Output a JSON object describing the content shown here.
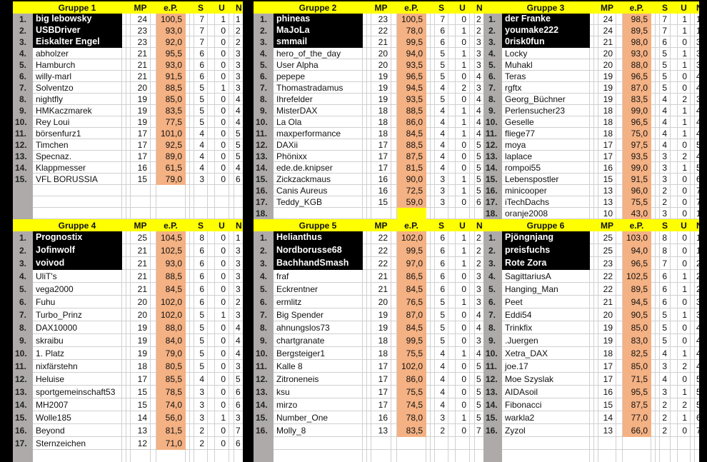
{
  "colors": {
    "header": "#ffff00",
    "ep_column": "#f4b183",
    "rank_column": "#aeaaaa",
    "podium": "#000000"
  },
  "columns": {
    "mp": "MP",
    "ep": "e.P.",
    "s": "S",
    "u": "U",
    "n": "N"
  },
  "groups": [
    {
      "title": "Gruppe 1",
      "rows": [
        [
          "1.",
          "big lebowsky",
          "24",
          "100,5",
          "7",
          "1",
          "1"
        ],
        [
          "2.",
          "USBDriver",
          "23",
          "93,0",
          "7",
          "0",
          "2"
        ],
        [
          "3.",
          "Eiskalter Engel",
          "23",
          "92,0",
          "7",
          "0",
          "2"
        ],
        [
          "4.",
          "abholzer",
          "21",
          "95,5",
          "6",
          "0",
          "3"
        ],
        [
          "5.",
          "Hamburch",
          "21",
          "93,0",
          "6",
          "0",
          "3"
        ],
        [
          "6.",
          "willy-marl",
          "21",
          "91,5",
          "6",
          "0",
          "3"
        ],
        [
          "7.",
          "Solventzo",
          "20",
          "88,5",
          "5",
          "1",
          "3"
        ],
        [
          "8.",
          "nightfly",
          "19",
          "85,0",
          "5",
          "0",
          "4"
        ],
        [
          "9.",
          "HMKaczmarek",
          "19",
          "83,5",
          "5",
          "0",
          "4"
        ],
        [
          "10.",
          "Rey Loui",
          "19",
          "77,5",
          "5",
          "0",
          "4"
        ],
        [
          "11.",
          "börsenfurz1",
          "17",
          "101,0",
          "4",
          "0",
          "5"
        ],
        [
          "12.",
          "Timchen",
          "17",
          "92,5",
          "4",
          "0",
          "5"
        ],
        [
          "13.",
          "Specnaz.",
          "17",
          "89,0",
          "4",
          "0",
          "5"
        ],
        [
          "14.",
          "Klappmesser",
          "16",
          "61,5",
          "4",
          "0",
          "4"
        ],
        [
          "15.",
          "VFL BORUSSIA",
          "15",
          "79,0",
          "3",
          "0",
          "6"
        ]
      ]
    },
    {
      "title": "Gruppe 2",
      "empty_ep_color": "#ffff00",
      "rows": [
        [
          "1.",
          "phineas",
          "23",
          "100,5",
          "7",
          "0",
          "2"
        ],
        [
          "2.",
          "MaJoLa",
          "22",
          "78,0",
          "6",
          "1",
          "2"
        ],
        [
          "3.",
          "smmail",
          "21",
          "99,5",
          "6",
          "0",
          "3"
        ],
        [
          "4.",
          "hero_of_the_day",
          "20",
          "94,0",
          "5",
          "1",
          "3"
        ],
        [
          "5.",
          "User Alpha",
          "20",
          "93,5",
          "5",
          "1",
          "3"
        ],
        [
          "6.",
          "pepepe",
          "19",
          "96,5",
          "5",
          "0",
          "4"
        ],
        [
          "7.",
          "Thomastradamus",
          "19",
          "94,5",
          "4",
          "2",
          "3"
        ],
        [
          "8.",
          "Ihrefelder",
          "19",
          "93,5",
          "5",
          "0",
          "4"
        ],
        [
          "9.",
          "MisterDAX",
          "18",
          "88,5",
          "4",
          "1",
          "4"
        ],
        [
          "10.",
          "La Ola",
          "18",
          "86,0",
          "4",
          "1",
          "4"
        ],
        [
          "11.",
          "maxperformance",
          "18",
          "84,5",
          "4",
          "1",
          "4"
        ],
        [
          "12.",
          "DAXii",
          "17",
          "88,5",
          "4",
          "0",
          "5"
        ],
        [
          "13.",
          "Phönixx",
          "17",
          "87,5",
          "4",
          "0",
          "5"
        ],
        [
          "14.",
          "ede.de.knipser",
          "17",
          "81,5",
          "4",
          "0",
          "5"
        ],
        [
          "15.",
          "Zickzackmaus",
          "16",
          "90,0",
          "3",
          "1",
          "5"
        ],
        [
          "16.",
          "Canis Aureus",
          "16",
          "72,5",
          "3",
          "1",
          "5"
        ],
        [
          "17.",
          "Teddy_KGB",
          "15",
          "59,0",
          "3",
          "0",
          "6"
        ],
        [
          "18.",
          "",
          "",
          "",
          "",
          "",
          ""
        ]
      ]
    },
    {
      "title": "Gruppe 3",
      "rows": [
        [
          "1.",
          "der Franke",
          "24",
          "98,5",
          "7",
          "1",
          "1"
        ],
        [
          "2.",
          "youmake222",
          "24",
          "89,5",
          "7",
          "1",
          "1"
        ],
        [
          "3.",
          "0risk0fun",
          "21",
          "98,0",
          "6",
          "0",
          "3"
        ],
        [
          "4.",
          "Locky",
          "20",
          "93,0",
          "5",
          "1",
          "3"
        ],
        [
          "5.",
          "Muhakl",
          "20",
          "88,0",
          "5",
          "1",
          "3"
        ],
        [
          "6.",
          "Teras",
          "19",
          "96,5",
          "5",
          "0",
          "4"
        ],
        [
          "7.",
          "rgftx",
          "19",
          "87,0",
          "5",
          "0",
          "4"
        ],
        [
          "8.",
          "Georg_Büchner",
          "19",
          "83,5",
          "4",
          "2",
          "3"
        ],
        [
          "9.",
          "Perlensucher23",
          "18",
          "99,0",
          "4",
          "1",
          "4"
        ],
        [
          "10.",
          "Geselle",
          "18",
          "96,5",
          "4",
          "1",
          "4"
        ],
        [
          "11.",
          "fliege77",
          "18",
          "75,0",
          "4",
          "1",
          "4"
        ],
        [
          "12.",
          "moya",
          "17",
          "97,5",
          "4",
          "0",
          "5"
        ],
        [
          "13.",
          "laplace",
          "17",
          "93,5",
          "3",
          "2",
          "4"
        ],
        [
          "14.",
          "rompoi55",
          "16",
          "99,0",
          "3",
          "1",
          "5"
        ],
        [
          "15.",
          "Lebenspostler",
          "15",
          "91,5",
          "3",
          "0",
          "6"
        ],
        [
          "16.",
          "minicooper",
          "13",
          "96,0",
          "2",
          "0",
          "7"
        ],
        [
          "17.",
          "iTechDachs",
          "13",
          "75,5",
          "2",
          "0",
          "7"
        ],
        [
          "18.",
          "oranje2008",
          "10",
          "43,0",
          "3",
          "0",
          "1"
        ]
      ]
    },
    {
      "title": "Gruppe 4",
      "rows": [
        [
          "1.",
          "Prognostix",
          "25",
          "104,5",
          "8",
          "0",
          "1"
        ],
        [
          "2.",
          "Jofinwolf",
          "21",
          "102,5",
          "6",
          "0",
          "3"
        ],
        [
          "3.",
          "voivod",
          "21",
          "93,0",
          "6",
          "0",
          "3"
        ],
        [
          "4.",
          "UliT's",
          "21",
          "88,5",
          "6",
          "0",
          "3"
        ],
        [
          "5.",
          "vega2000",
          "21",
          "84,5",
          "6",
          "0",
          "3"
        ],
        [
          "6.",
          "Fuhu",
          "20",
          "102,0",
          "6",
          "0",
          "2"
        ],
        [
          "7.",
          "Turbo_Prinz",
          "20",
          "102,0",
          "5",
          "1",
          "3"
        ],
        [
          "8.",
          "DAX10000",
          "19",
          "88,0",
          "5",
          "0",
          "4"
        ],
        [
          "9.",
          "skraibu",
          "19",
          "84,0",
          "5",
          "0",
          "4"
        ],
        [
          "10.",
          "1. Platz",
          "19",
          "79,0",
          "5",
          "0",
          "4"
        ],
        [
          "11.",
          "nixfärstehn",
          "18",
          "80,5",
          "5",
          "0",
          "3"
        ],
        [
          "12.",
          "Heluise",
          "17",
          "85,5",
          "4",
          "0",
          "5"
        ],
        [
          "13.",
          "sportgemeinschaft53",
          "15",
          "78,5",
          "3",
          "0",
          "6"
        ],
        [
          "14.",
          "MH2007",
          "15",
          "74,0",
          "3",
          "0",
          "6"
        ],
        [
          "15.",
          "Wolle185",
          "14",
          "56,0",
          "3",
          "1",
          "3"
        ],
        [
          "16.",
          "Beyond",
          "13",
          "81,5",
          "2",
          "0",
          "7"
        ],
        [
          "17.",
          "Sternzeichen",
          "12",
          "71,0",
          "2",
          "0",
          "6"
        ]
      ]
    },
    {
      "title": "Gruppe 5",
      "rows": [
        [
          "1.",
          "Helianthus",
          "22",
          "102,0",
          "6",
          "1",
          "2"
        ],
        [
          "2.",
          "Nordborusse68",
          "22",
          "99,5",
          "6",
          "1",
          "2"
        ],
        [
          "3.",
          "BachhandSmash",
          "22",
          "97,0",
          "6",
          "1",
          "2"
        ],
        [
          "4.",
          "fraf",
          "21",
          "86,5",
          "6",
          "0",
          "3"
        ],
        [
          "5.",
          "Eckrentner",
          "21",
          "84,5",
          "6",
          "0",
          "3"
        ],
        [
          "6.",
          "ermlitz",
          "20",
          "76,5",
          "5",
          "1",
          "3"
        ],
        [
          "7.",
          "Big Spender",
          "19",
          "87,0",
          "5",
          "0",
          "4"
        ],
        [
          "8.",
          "ahnungslos73",
          "19",
          "84,5",
          "5",
          "0",
          "4"
        ],
        [
          "9.",
          "chartgranate",
          "18",
          "99,5",
          "5",
          "0",
          "3"
        ],
        [
          "10.",
          "Bergsteiger1",
          "18",
          "75,5",
          "4",
          "1",
          "4"
        ],
        [
          "11.",
          "Kalle 8",
          "17",
          "102,0",
          "4",
          "0",
          "5"
        ],
        [
          "12.",
          "Zitroneneis",
          "17",
          "86,0",
          "4",
          "0",
          "5"
        ],
        [
          "13.",
          "ksu",
          "17",
          "75,5",
          "4",
          "0",
          "5"
        ],
        [
          "14.",
          "mirzo",
          "17",
          "74,5",
          "4",
          "0",
          "5"
        ],
        [
          "15.",
          "Number_One",
          "16",
          "78,0",
          "3",
          "1",
          "5"
        ],
        [
          "16.",
          "Molly_8",
          "13",
          "83,5",
          "2",
          "0",
          "7"
        ]
      ]
    },
    {
      "title": "Gruppe 6",
      "rows": [
        [
          "1.",
          "Pjöngnjang",
          "25",
          "103,0",
          "8",
          "0",
          "1"
        ],
        [
          "2.",
          "preisfuchs",
          "25",
          "94,0",
          "8",
          "0",
          "1"
        ],
        [
          "3.",
          "Rote Zora",
          "23",
          "96,5",
          "7",
          "0",
          "2"
        ],
        [
          "4.",
          "SagittariusA",
          "22",
          "102,5",
          "6",
          "1",
          "2"
        ],
        [
          "5.",
          "Hanging_Man",
          "22",
          "89,5",
          "6",
          "1",
          "2"
        ],
        [
          "6.",
          "Peet",
          "21",
          "94,5",
          "6",
          "0",
          "3"
        ],
        [
          "7.",
          "Eddi54",
          "20",
          "90,5",
          "5",
          "1",
          "3"
        ],
        [
          "8.",
          "Trinkfix",
          "19",
          "85,0",
          "5",
          "0",
          "4"
        ],
        [
          "9.",
          ".Juergen",
          "19",
          "83,0",
          "5",
          "0",
          "4"
        ],
        [
          "10.",
          "Xetra_DAX",
          "18",
          "82,5",
          "4",
          "1",
          "4"
        ],
        [
          "11.",
          "joe.17",
          "17",
          "85,0",
          "3",
          "2",
          "4"
        ],
        [
          "12.",
          "Moe Szyslak",
          "17",
          "71,5",
          "4",
          "0",
          "5"
        ],
        [
          "13.",
          "AIDAsoil",
          "16",
          "95,5",
          "3",
          "1",
          "5"
        ],
        [
          "14.",
          "Fibonacci",
          "15",
          "87,5",
          "2",
          "2",
          "5"
        ],
        [
          "15.",
          "warkla2",
          "14",
          "77,0",
          "2",
          "1",
          "6"
        ],
        [
          "16.",
          "Zyzol",
          "13",
          "66,0",
          "2",
          "0",
          "7"
        ]
      ]
    }
  ]
}
